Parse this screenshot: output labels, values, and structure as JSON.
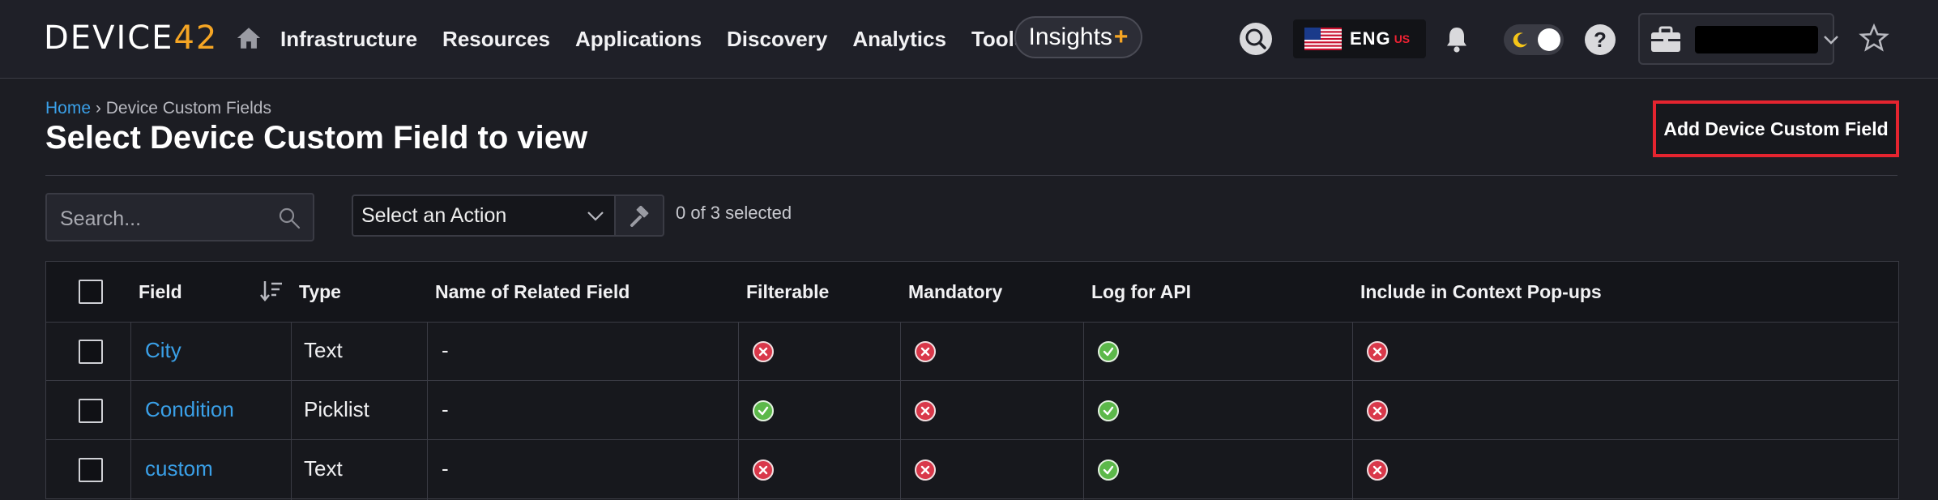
{
  "app": {
    "logo_main": "DEVICE",
    "logo_accent": "42"
  },
  "nav": {
    "items": [
      "Infrastructure",
      "Resources",
      "Applications",
      "Discovery",
      "Analytics",
      "Tools"
    ],
    "insights_label": "Insights",
    "insights_plus": "+"
  },
  "header_tools": {
    "language": "ENG",
    "language_region": "US",
    "help_glyph": "?"
  },
  "breadcrumb": {
    "home": "Home",
    "separator": "›",
    "current": "Device Custom Fields"
  },
  "page": {
    "title": "Select Device Custom Field to view",
    "add_button": "Add Device Custom Field"
  },
  "toolbar": {
    "search_placeholder": "Search...",
    "action_select": "Select an Action",
    "selected_count": "0 of 3 selected"
  },
  "table": {
    "columns": [
      "Field",
      "Type",
      "Name of Related Field",
      "Filterable",
      "Mandatory",
      "Log for API",
      "Include in Context Pop-ups"
    ],
    "rows": [
      {
        "field": "City",
        "type": "Text",
        "related": "-",
        "filterable": false,
        "mandatory": false,
        "log_api": true,
        "context_popups": false
      },
      {
        "field": "Condition",
        "type": "Picklist",
        "related": "-",
        "filterable": true,
        "mandatory": false,
        "log_api": true,
        "context_popups": false
      },
      {
        "field": "custom",
        "type": "Text",
        "related": "-",
        "filterable": false,
        "mandatory": false,
        "log_api": true,
        "context_popups": false
      }
    ]
  },
  "colors": {
    "accent": "#f5a524",
    "link": "#3aa0e8",
    "highlight": "#e5242f",
    "status_yes": "#5cb84a",
    "status_no": "#d9384a"
  }
}
